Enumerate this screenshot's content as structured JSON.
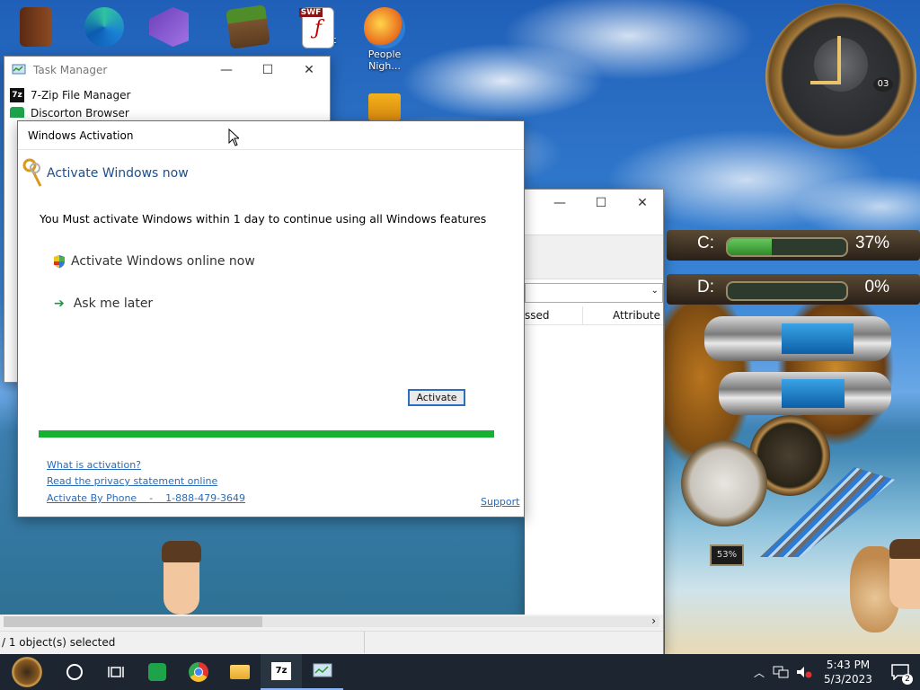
{
  "desktop": {
    "icons": [
      {
        "name": "book-icon",
        "label": ""
      },
      {
        "name": "edge-icon",
        "label": ""
      },
      {
        "name": "visual-studio-icon",
        "label": ""
      },
      {
        "name": "minecraft-icon",
        "label": ""
      },
      {
        "name": "swf-file-icon",
        "label": "SWF",
        "caption": "t"
      },
      {
        "name": "people-night-icon",
        "label": "People Nigh..."
      }
    ]
  },
  "task_manager": {
    "title": "Task Manager",
    "items": [
      "7-Zip File Manager",
      "Discorton Browser"
    ]
  },
  "activation": {
    "window_title": "Windows Activation",
    "header": "Activate Windows now",
    "message": "You Must activate Windows within 1 day to continue using all Windows features",
    "option_online": "Activate Windows online now",
    "option_later": "Ask me later",
    "activate_button": "Activate",
    "progress_fraction": 1.0,
    "link_what": "What is activation?",
    "link_privacy": "Read the privacy statement online",
    "link_phone": "Activate By Phone    -    1-888-479-3649",
    "link_support": "Support"
  },
  "explorer": {
    "col_accessed": "ssed",
    "col_attributes": "Attribute",
    "status": "/ 1 object(s) selected"
  },
  "widgets": {
    "drive_c": {
      "label": "C:",
      "percent_text": "37%",
      "fraction": 0.37
    },
    "drive_d": {
      "label": "D:",
      "percent_text": "0%",
      "fraction": 0.0
    },
    "cpu_gauge_text": "53%",
    "clock_day": "03"
  },
  "taskbar": {
    "time": "5:43 PM",
    "date": "5/3/2023",
    "notification_count": "2"
  },
  "colors": {
    "progress_green": "#16b033",
    "link_blue": "#2a6bb8",
    "header_blue": "#1f4e8c",
    "taskbar_bg": "#1c2530"
  }
}
